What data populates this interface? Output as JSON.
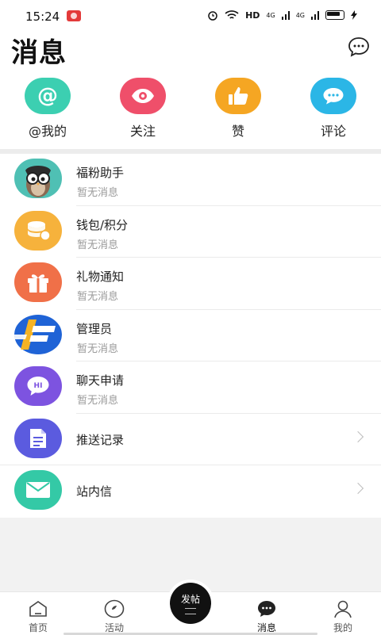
{
  "status_bar": {
    "time": "15:24",
    "hd_label": "HD",
    "signal1": "4G",
    "signal2": "4G",
    "icons": [
      "app-badge-icon",
      "alarm-icon",
      "wifi-icon",
      "signal-icon",
      "battery-icon",
      "charging-icon"
    ]
  },
  "header": {
    "title": "消息",
    "chat_icon": "chat-bubble-icon"
  },
  "quick": [
    {
      "label": "@我的",
      "icon": "at-icon",
      "color": "#3ccfb1"
    },
    {
      "label": "关注",
      "icon": "eye-icon",
      "color": "#ef4f6a"
    },
    {
      "label": "赞",
      "icon": "thumbs-up-icon",
      "color": "#f5a623"
    },
    {
      "label": "评论",
      "icon": "speech-bubble-icon",
      "color": "#2bb6e6"
    }
  ],
  "messages": [
    {
      "title": "福粉助手",
      "subtitle": "暂无消息",
      "icon": "owl-mascot-icon"
    },
    {
      "title": "钱包/积分",
      "subtitle": "暂无消息",
      "icon": "coins-icon",
      "color": "#f6b23c"
    },
    {
      "title": "礼物通知",
      "subtitle": "暂无消息",
      "icon": "gift-icon",
      "color": "#f07048"
    },
    {
      "title": "管理员",
      "subtitle": "暂无消息",
      "icon": "admin-logo-icon"
    },
    {
      "title": "聊天申请",
      "subtitle": "暂无消息",
      "icon": "hi-chat-icon",
      "color": "#7d53e0"
    },
    {
      "title": "推送记录",
      "icon": "document-icon",
      "color": "#5b5bdf"
    },
    {
      "title": "站内信",
      "icon": "envelope-icon",
      "color": "#34c9a6"
    }
  ],
  "tabbar": {
    "tabs": [
      {
        "label": "首页",
        "icon": "home-icon"
      },
      {
        "label": "活动",
        "icon": "activity-icon"
      },
      {
        "label": "消息",
        "icon": "message-icon",
        "active": true
      },
      {
        "label": "我的",
        "icon": "user-icon"
      }
    ],
    "post": {
      "label": "发帖"
    }
  }
}
